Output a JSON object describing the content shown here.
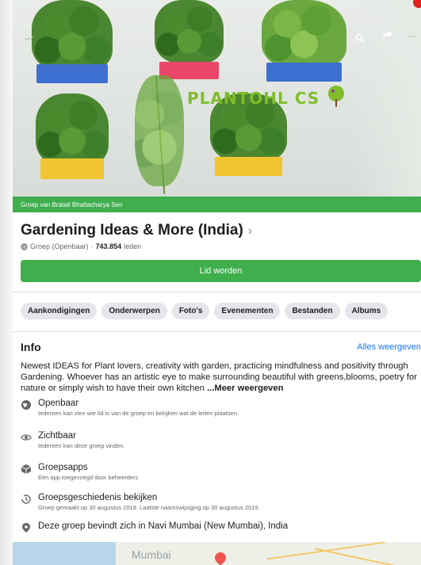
{
  "cover": {
    "logo_text": "PLANTOHL CS",
    "back_icon": "back-arrow-icon",
    "search_icon": "search-icon",
    "share_icon": "share-icon",
    "more_icon": "more-icon",
    "more_text": "...",
    "back_glyph": "←",
    "search_glyph": "🔍",
    "share_glyph": "➦"
  },
  "group_by": "Groep van Bratati Bhattacharya Sen",
  "group": {
    "title": "Gardening Ideas & More (India)",
    "chevron": "›",
    "privacy": "Groep (Openbaar)",
    "separator": "·",
    "members": "743.854",
    "members_label": "leden"
  },
  "join_button": "Lid worden",
  "tabs": [
    "Aankondigingen",
    "Onderwerpen",
    "Foto's",
    "Evenementen",
    "Bestanden",
    "Albums"
  ],
  "info": {
    "title": "Info",
    "see_all": "Alles weergeven",
    "description": "Newest IDEAS for Plant lovers, creativity with garden, practicing mindfulness and positivity through Gardening. Whoever has an artistic eye to make surrounding beautiful with greens,blooms, poetry for nature or simply wish to have their own kitchen",
    "more": "...Meer weergeven",
    "items": [
      {
        "icon": "globe-icon",
        "title": "Openbaar",
        "desc": "Iedereen kan zien wie lid is van de groep en bekijken wat de leden plaatsen."
      },
      {
        "icon": "eye-icon",
        "title": "Zichtbaar",
        "desc": "Iedereen kan deze groep vinden."
      },
      {
        "icon": "cube-icon",
        "title": "Groepsapps",
        "desc": "Eén app toegevoegd door beheerders"
      },
      {
        "icon": "history-icon",
        "title": "Groepsgeschiedenis bekijken",
        "desc": "Groep gemaakt op 30 augustus 2019. Laatste naamswijziging op 30 augustus 2019."
      },
      {
        "icon": "location-pin-icon",
        "title": "Deze groep bevindt zich in Navi Mumbai (New Mumbai), India",
        "desc": ""
      }
    ]
  },
  "map": {
    "label": "Mumbai"
  },
  "colors": {
    "accent_green": "#3fae4d",
    "link_blue": "#1877f2",
    "chip_bg": "#e4e6eb"
  }
}
